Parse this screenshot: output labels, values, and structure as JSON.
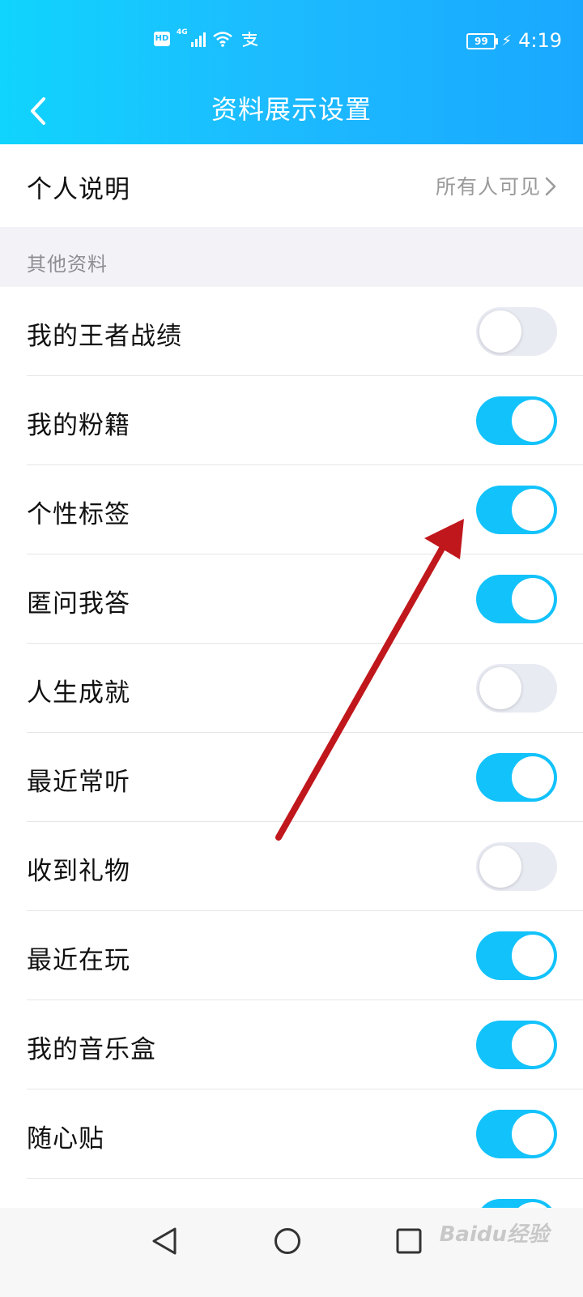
{
  "status_bar": {
    "left_icons": [
      "hd-icon",
      "4g-signal-icon",
      "wifi-icon",
      "alipay-icon"
    ],
    "hd_text": "HD",
    "network_text": "4G",
    "battery_level": "99",
    "time": "4:19"
  },
  "header": {
    "title": "资料展示设置",
    "back_icon": "chevron-left-icon"
  },
  "intro_row": {
    "label": "个人说明",
    "value": "所有人可见"
  },
  "section": {
    "title": "其他资料"
  },
  "settings": [
    {
      "label": "我的王者战绩",
      "enabled": false
    },
    {
      "label": "我的粉籍",
      "enabled": true
    },
    {
      "label": "个性标签",
      "enabled": true
    },
    {
      "label": "匿问我答",
      "enabled": true
    },
    {
      "label": "人生成就",
      "enabled": false
    },
    {
      "label": "最近常听",
      "enabled": true
    },
    {
      "label": "收到礼物",
      "enabled": false
    },
    {
      "label": "最近在玩",
      "enabled": true
    },
    {
      "label": "我的音乐盒",
      "enabled": true
    },
    {
      "label": "随心贴",
      "enabled": true
    },
    {
      "label": "",
      "enabled": true
    }
  ],
  "nav_bar": {
    "icons": [
      "nav-back-icon",
      "nav-home-icon",
      "nav-recent-icon"
    ]
  },
  "watermark": "Baidu经验",
  "colors": {
    "header_gradient_start": "#10d4fd",
    "header_gradient_end": "#1aa8ff",
    "toggle_on": "#12c2fb",
    "toggle_off": "#e9ebf3",
    "annotation_arrow": "#c0171c"
  }
}
